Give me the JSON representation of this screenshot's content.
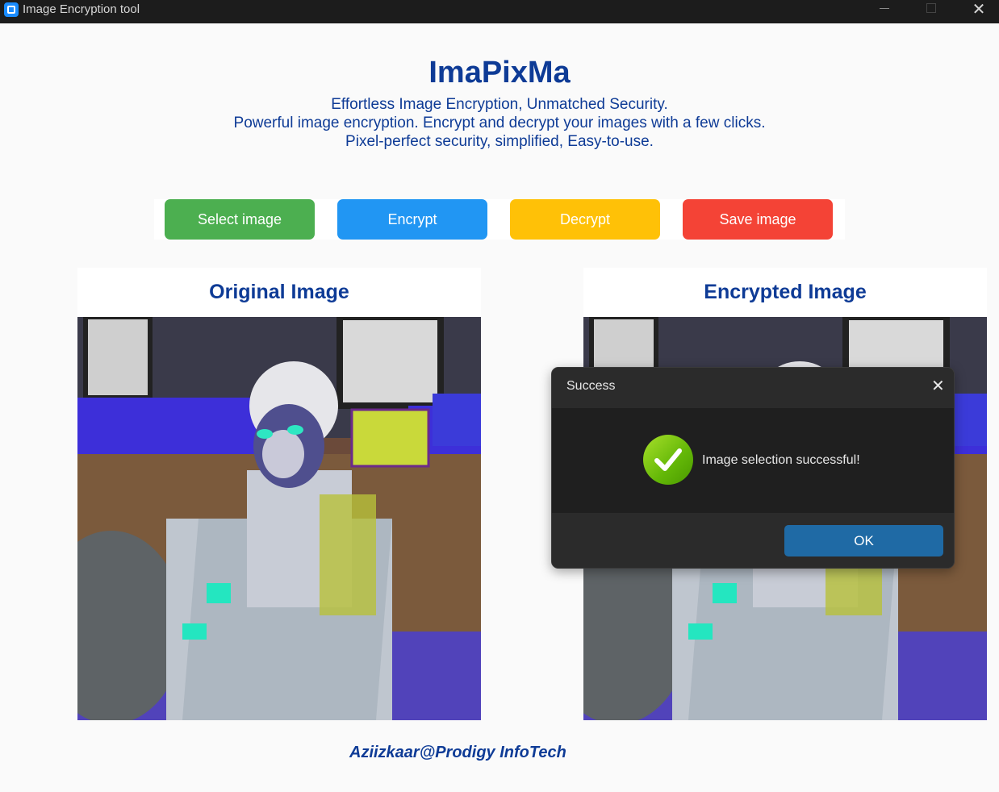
{
  "window": {
    "title": "Image Encryption tool",
    "icons": {
      "app": "app-icon",
      "minimize": "minimize-icon",
      "maximize": "maximize-icon",
      "close": "close-icon"
    },
    "close_glyph": "✕"
  },
  "header": {
    "title": "ImaPixMa",
    "taglines": [
      "Effortless Image Encryption, Unmatched Security.",
      "Powerful image encryption. Encrypt and decrypt your images with a few clicks.",
      "Pixel-perfect security, simplified, Easy-to-use."
    ]
  },
  "toolbar": {
    "select_label": "Select image",
    "encrypt_label": "Encrypt",
    "decrypt_label": "Decrypt",
    "save_label": "Save image"
  },
  "panels": {
    "original_title": "Original Image",
    "encrypted_title": "Encrypted Image"
  },
  "footer": {
    "credit": "Aziizkaar@Prodigy InfoTech"
  },
  "dialog": {
    "title": "Success",
    "message": "Image  selection successful!",
    "ok_label": "OK",
    "close_glyph": "✕",
    "icon": "success-check-icon"
  },
  "colors": {
    "brand_text": "#0e3b96",
    "select": "#4caf50",
    "encrypt": "#2196f3",
    "decrypt": "#ffc107",
    "save": "#f44336",
    "ok": "#1f6aa5"
  }
}
